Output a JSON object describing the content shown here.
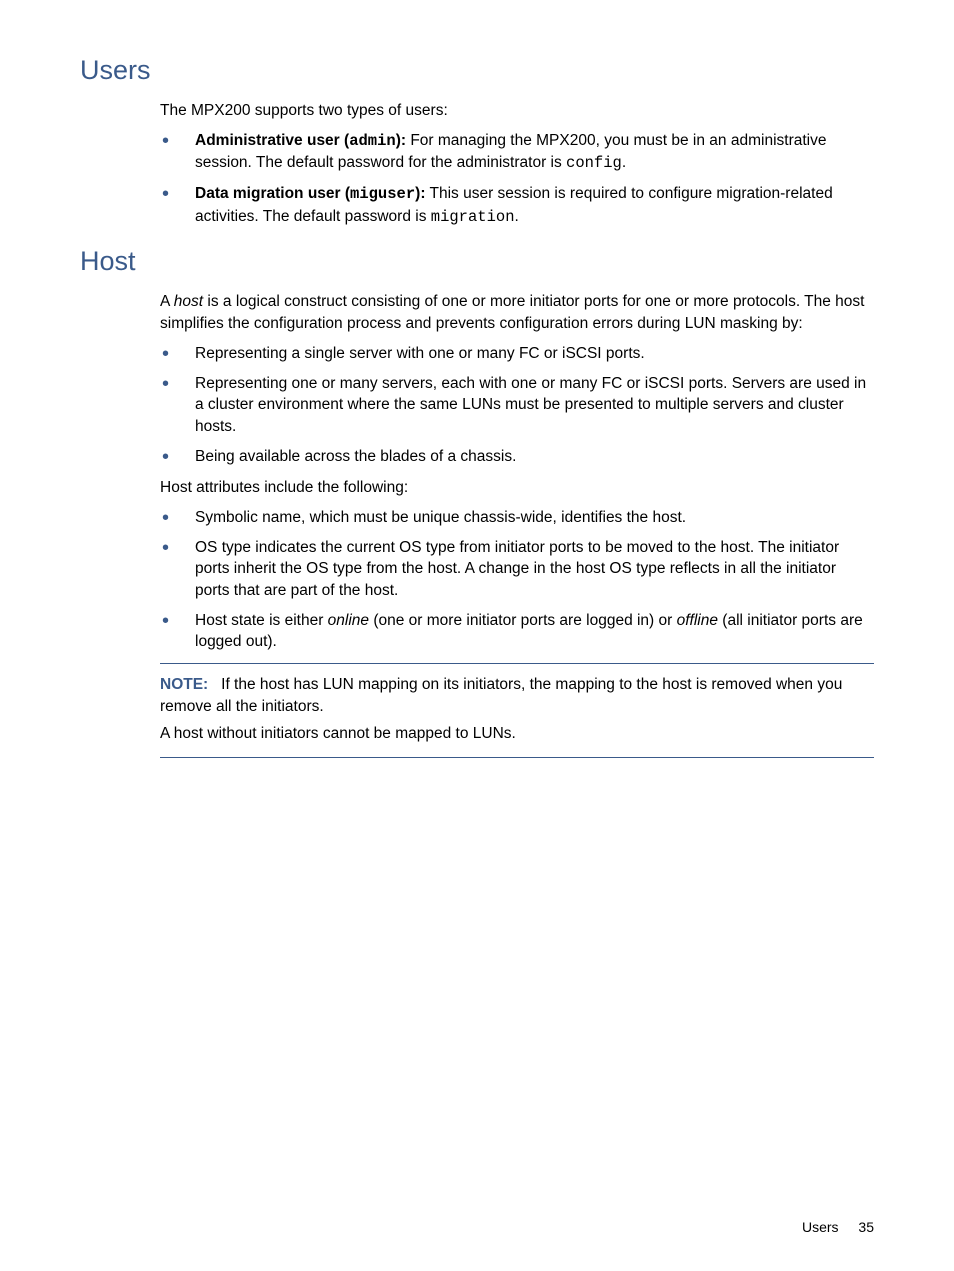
{
  "sections": {
    "users": {
      "heading": "Users",
      "intro": "The MPX200 supports two types of users:",
      "items": [
        {
          "bold_prefix": "Administrative user (",
          "code_in_bold": "admin",
          "bold_suffix": "):",
          "text": " For managing the MPX200, you must be in an administrative session. The default password for the administrator is ",
          "code_trailing": "config",
          "end": "."
        },
        {
          "bold_prefix": "Data migration user (",
          "code_in_bold": "miguser",
          "bold_suffix": "):",
          "text": " This user session is required to configure migration-related activities. The default password is ",
          "code_trailing": "migration",
          "end": "."
        }
      ]
    },
    "host": {
      "heading": "Host",
      "intro_pre": "A ",
      "intro_italic": "host",
      "intro_post": " is a logical construct consisting of one or more initiator ports for one or more protocols. The host simplifies the configuration process and prevents configuration errors during LUN masking by:",
      "list1": [
        "Representing a single server with one or many FC or iSCSI ports.",
        "Representing one or many servers, each with one or many FC or iSCSI ports. Servers are used in a cluster environment where the same LUNs must be presented to multiple servers and cluster hosts.",
        "Being available across the blades of a chassis."
      ],
      "attributes_intro": "Host attributes include the following:",
      "list2_simple": [
        "Symbolic name, which must be unique chassis-wide, identifies the host.",
        "OS type indicates the current OS type from initiator ports to be moved to the host. The initiator ports inherit the OS type from the host. A change in the host OS type reflects in all the initiator ports that are part of the host."
      ],
      "list2_last": {
        "pre": "Host state is either ",
        "italic1": "online",
        "mid": " (one or more initiator ports are logged in) or ",
        "italic2": "offline",
        "post": " (all initiator ports are logged out)."
      },
      "note": {
        "label": "NOTE:",
        "p1": "If the host has LUN mapping on its initiators, the mapping to the host is removed when you remove all the initiators.",
        "p2": "A host without initiators cannot be mapped to LUNs."
      }
    }
  },
  "footer": {
    "label": "Users",
    "page": "35"
  }
}
